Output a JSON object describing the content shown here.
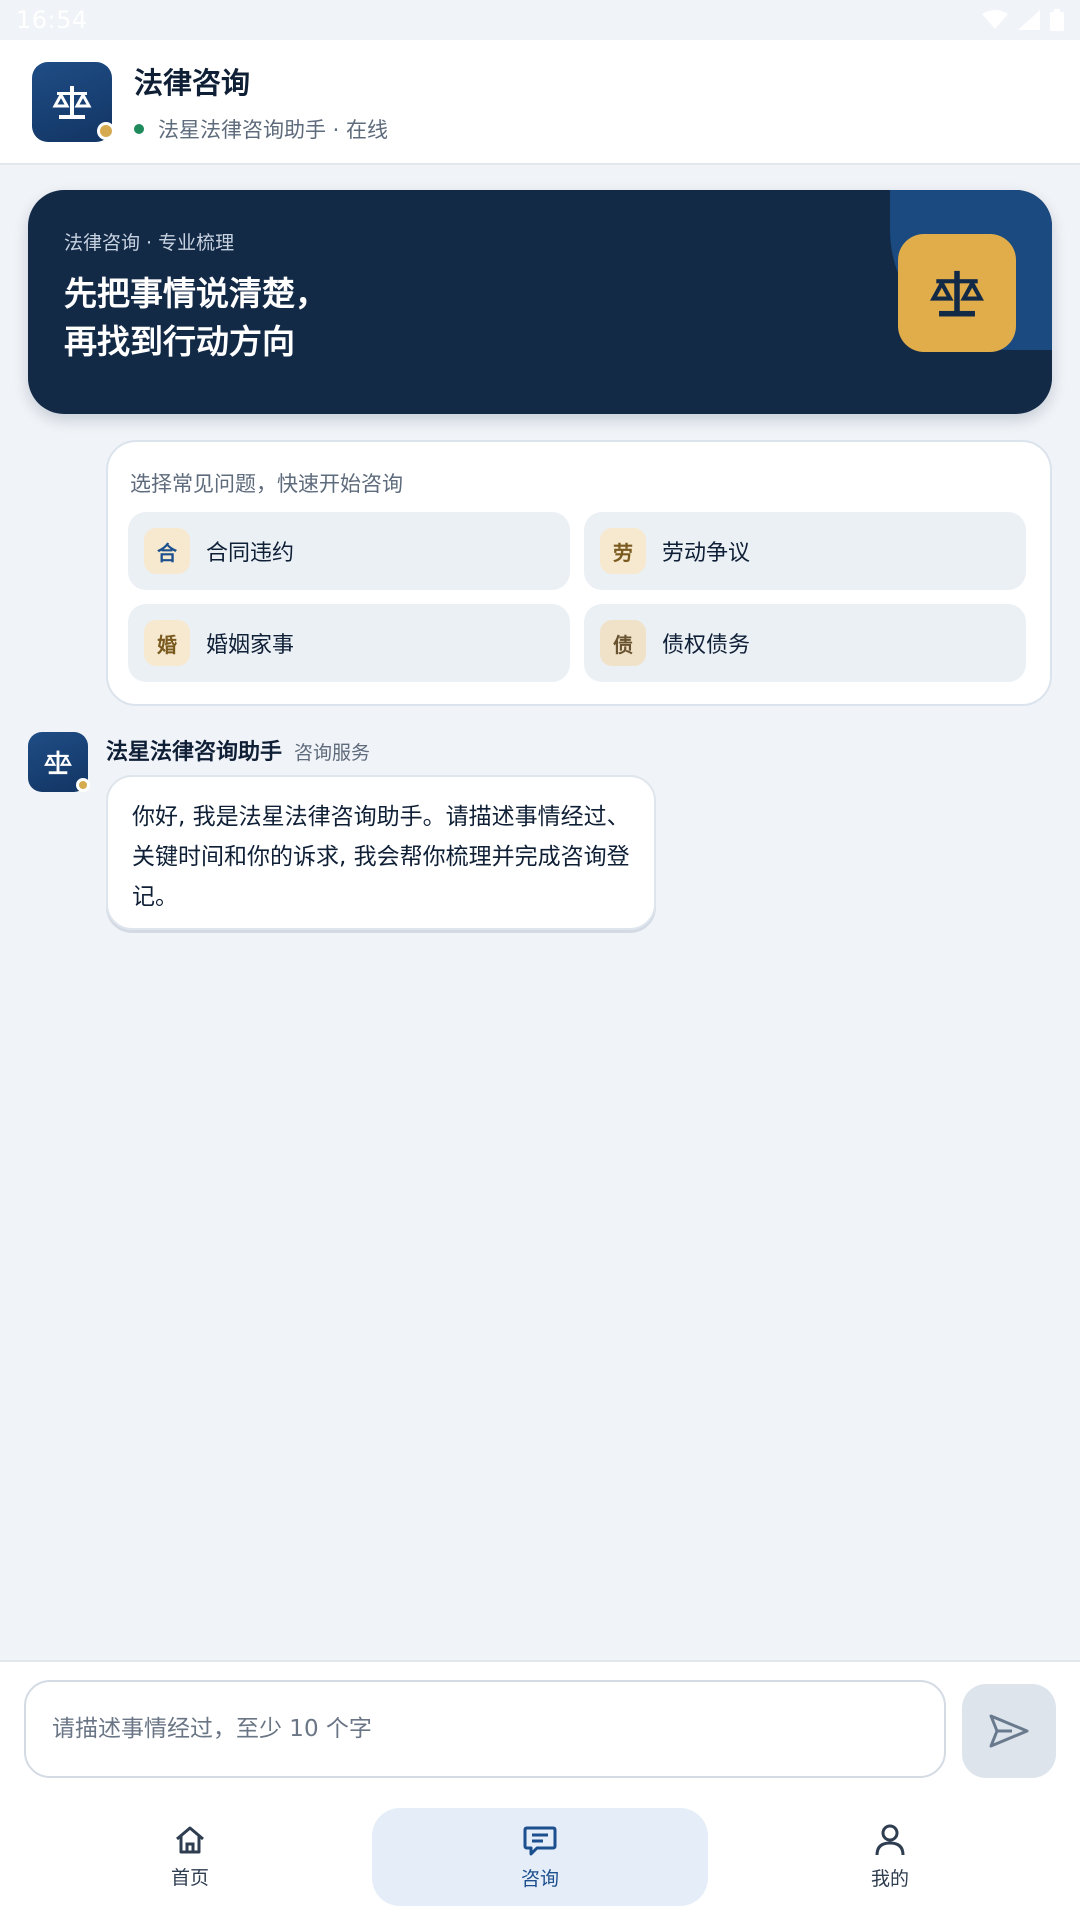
{
  "status_bar": {
    "time": "16:54"
  },
  "header": {
    "title": "法律咨询",
    "subtitle": "法星法律咨询助手 · 在线"
  },
  "hero": {
    "kicker": "法律咨询 · 专业梳理",
    "title_line1": "先把事情说清楚，",
    "title_line2": "再找到行动方向"
  },
  "quick": {
    "label": "选择常见问题，快速开始咨询",
    "items": [
      {
        "icon": "合",
        "label": "合同违约",
        "icon_color": "#1c4f8e"
      },
      {
        "icon": "劳",
        "label": "劳动争议",
        "icon_color": "#7a5a1e"
      },
      {
        "icon": "婚",
        "label": "婚姻家事",
        "icon_color": "#7a5a1e"
      },
      {
        "icon": "债",
        "label": "债权债务",
        "icon_color": "#6a5330"
      }
    ]
  },
  "message": {
    "sender": "法星法律咨询助手",
    "tag": "咨询服务",
    "text": "你好, 我是法星法律咨询助手。请描述事情经过、关键时间和你的诉求, 我会帮你梳理并完成咨询登记。"
  },
  "input": {
    "placeholder": "请描述事情经过，至少 10 个字",
    "value": ""
  },
  "nav": {
    "items": [
      {
        "label": "首页",
        "icon": "home-icon",
        "active": false
      },
      {
        "label": "咨询",
        "icon": "chat-icon",
        "active": true
      },
      {
        "label": "我的",
        "icon": "profile-icon",
        "active": false
      }
    ]
  },
  "colors": {
    "brand_navy": "#132a47",
    "brand_blue": "#1c4f8e",
    "accent_gold": "#e1ad4b",
    "online_green": "#1f8a5c"
  }
}
